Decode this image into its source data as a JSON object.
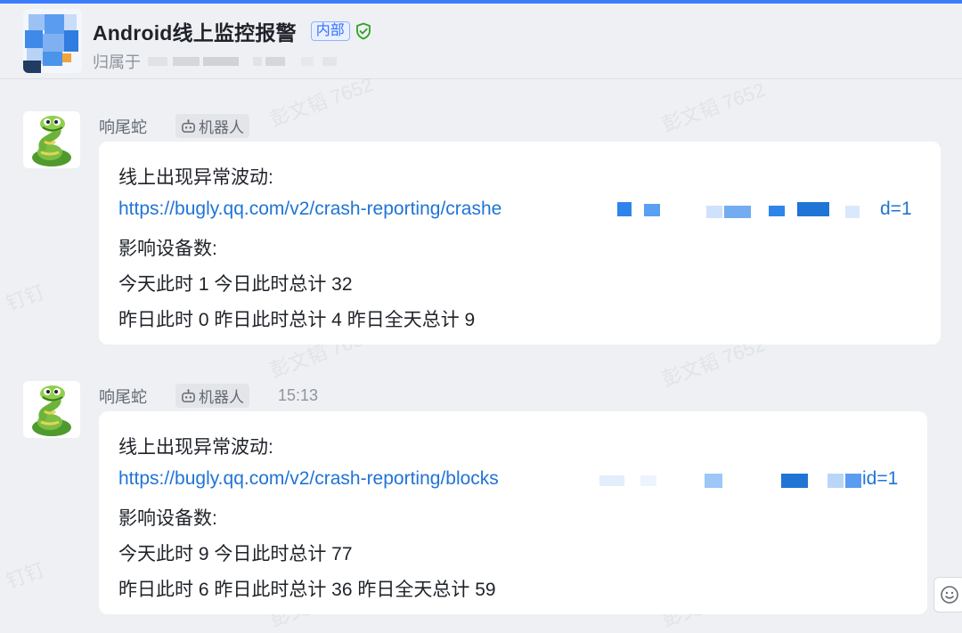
{
  "header": {
    "title": "Android线上监控报警",
    "tag": "内部",
    "owner_label": "归属于"
  },
  "watermarks": [
    "彭文韬 7652",
    "钉钉"
  ],
  "messages": [
    {
      "sender": "响尾蛇",
      "badge": "机器人",
      "time": "",
      "lines": {
        "heading": "线上出现异常波动:",
        "link_start": "https://bugly.qq.com/v2/crash-reporting/crashe",
        "link_end": "d=1",
        "devices_label": "影响设备数:",
        "today": "今天此时 1 今日此时总计 32",
        "yesterday": "昨日此时 0 昨日此时总计 4 昨日全天总计 9"
      }
    },
    {
      "sender": "响尾蛇",
      "badge": "机器人",
      "time": "15:13",
      "lines": {
        "heading": "线上出现异常波动:",
        "link_start": "https://bugly.qq.com/v2/crash-reporting/blocks",
        "link_end": "id=1",
        "devices_label": "影响设备数:",
        "today": "今天此时 9 今日此时总计 77",
        "yesterday": "昨日此时 6 昨日此时总计 36 昨日全天总计 59"
      }
    }
  ],
  "icons": {
    "shield": "shield-check-icon",
    "bot": "robot-icon",
    "emoji": "smiley-icon"
  },
  "colors": {
    "accent": "#3370ff",
    "link": "#1f74d6",
    "shield": "#2ea121"
  }
}
